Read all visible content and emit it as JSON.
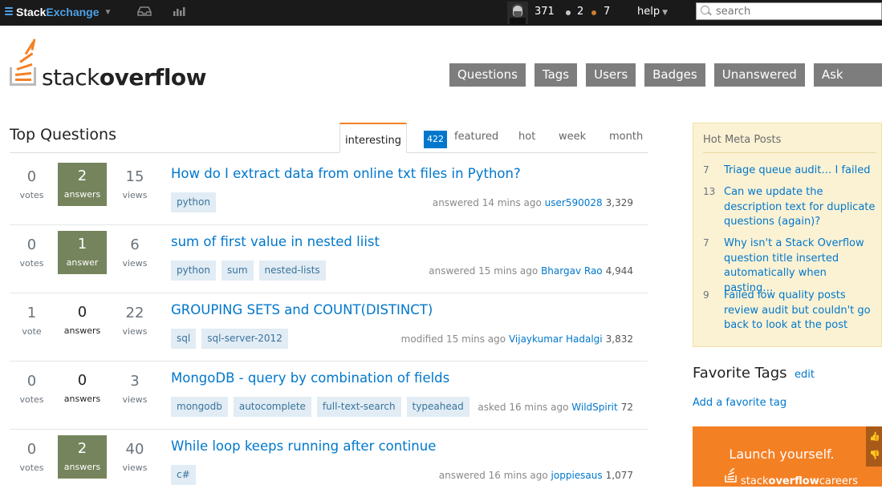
{
  "topbar": {
    "brand_stack": "Stack",
    "brand_exchange": "Exchange",
    "reputation": "371",
    "silver_badges": "2",
    "bronze_badges": "7",
    "help": "help",
    "search_placeholder": "search",
    "colors": {
      "background": "#1a1a1a",
      "silver": "#c9c9c9",
      "bronze": "#cd7f32"
    }
  },
  "header": {
    "logo_light": "stack",
    "logo_bold": "overflow",
    "nav": [
      "Questions",
      "Tags",
      "Users",
      "Badges",
      "Unanswered",
      "Ask Question"
    ]
  },
  "main": {
    "title": "Top Questions",
    "tabs": {
      "interesting": "interesting",
      "featured_count": "422",
      "featured": "featured",
      "hot": "hot",
      "week": "week",
      "month": "month"
    },
    "questions": [
      {
        "votes": "0",
        "votes_label": "votes",
        "answers": "2",
        "answers_label": "answers",
        "views": "15",
        "views_label": "views",
        "title": "How do I extract data from online txt files in Python?",
        "tags": [
          "python"
        ],
        "action": "answered 14 mins ago",
        "user": "user590028",
        "rep": "3,329"
      },
      {
        "votes": "0",
        "votes_label": "votes",
        "answers": "1",
        "answers_label": "answer",
        "views": "6",
        "views_label": "views",
        "title": "sum of first value in nested liist",
        "tags": [
          "python",
          "sum",
          "nested-lists"
        ],
        "action": "answered 15 mins ago",
        "user": "Bhargav Rao",
        "rep": "4,944"
      },
      {
        "votes": "1",
        "votes_label": "vote",
        "answers": "0",
        "answers_label": "answers",
        "views": "22",
        "views_label": "views",
        "title": "GROUPING SETS and COUNT(DISTINCT)",
        "tags": [
          "sql",
          "sql-server-2012"
        ],
        "action": "modified 15 mins ago",
        "user": "Vijaykumar Hadalgi",
        "rep": "3,832"
      },
      {
        "votes": "0",
        "votes_label": "votes",
        "answers": "0",
        "answers_label": "answers",
        "views": "3",
        "views_label": "views",
        "title": "MongoDB - query by combination of fields",
        "tags": [
          "mongodb",
          "autocomplete",
          "full-text-search",
          "typeahead"
        ],
        "action": "asked 16 mins ago",
        "user": "WildSpirit",
        "rep": "72"
      },
      {
        "votes": "0",
        "votes_label": "votes",
        "answers": "2",
        "answers_label": "answers",
        "views": "40",
        "views_label": "views",
        "title": "While loop keeps running after continue",
        "tags": [
          "c#"
        ],
        "action": "answered 16 mins ago",
        "user": "joppiesaus",
        "rep": "1,077"
      }
    ]
  },
  "sidebar": {
    "meta_title": "Hot Meta Posts",
    "meta_posts": [
      {
        "count": "7",
        "title": "Triage queue audit… I failed"
      },
      {
        "count": "13",
        "title": "Can we update the description text for duplicate questions (again)?"
      },
      {
        "count": "7",
        "title": "Why isn't a Stack Overflow question title inserted automatically when pasting…"
      },
      {
        "count": "9",
        "title": "Failed low quality posts review audit but couldn't go back to look at the post"
      }
    ],
    "favorite_title": "Favorite Tags",
    "favorite_edit": "edit",
    "favorite_add": "Add a favorite tag",
    "ad_line1": "Launch yourself.",
    "ad_brand_light": "stack",
    "ad_brand_bold": "overflow",
    "ad_brand_suffix": "careers"
  }
}
